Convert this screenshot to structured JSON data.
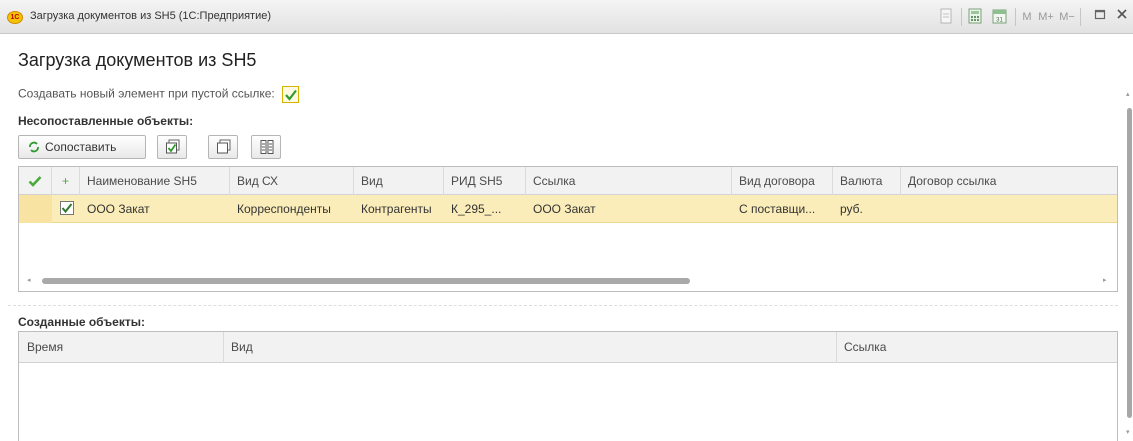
{
  "window": {
    "icon_text": "1С",
    "title": "Загрузка документов из SH5  (1С:Предприятие)",
    "m_label": "M",
    "mplus_label": "M+",
    "mminus_label": "M−"
  },
  "page": {
    "title": "Загрузка документов из SH5",
    "create_new_label": "Создавать новый элемент при пустой ссылке:",
    "create_new_checked": true
  },
  "unmatched": {
    "title": "Несопоставленные объекты:",
    "toolbar": {
      "match_label": "Сопоставить"
    },
    "columns": [
      "",
      "+",
      "Наименование SH5",
      "Вид СХ",
      "Вид",
      "РИД SH5",
      "Ссылка",
      "Вид договора",
      "Валюта",
      "Договор ссылка"
    ],
    "rows": [
      {
        "checked": true,
        "name": "ООО Закат",
        "vid_sx": "Корреспонденты",
        "vid": "Контрагенты",
        "rid": "К_295_...",
        "ref": "ООО Закат",
        "contract_type": "С поставщи...",
        "currency": "руб.",
        "contract_ref": ""
      }
    ]
  },
  "created": {
    "title": "Созданные объекты:",
    "columns": [
      "Время",
      "Вид",
      "Ссылка"
    ]
  },
  "colors": {
    "selected_row": "#fbedb9",
    "header_bg": "#f2f2f2",
    "accent_green": "#2e9b2e"
  }
}
